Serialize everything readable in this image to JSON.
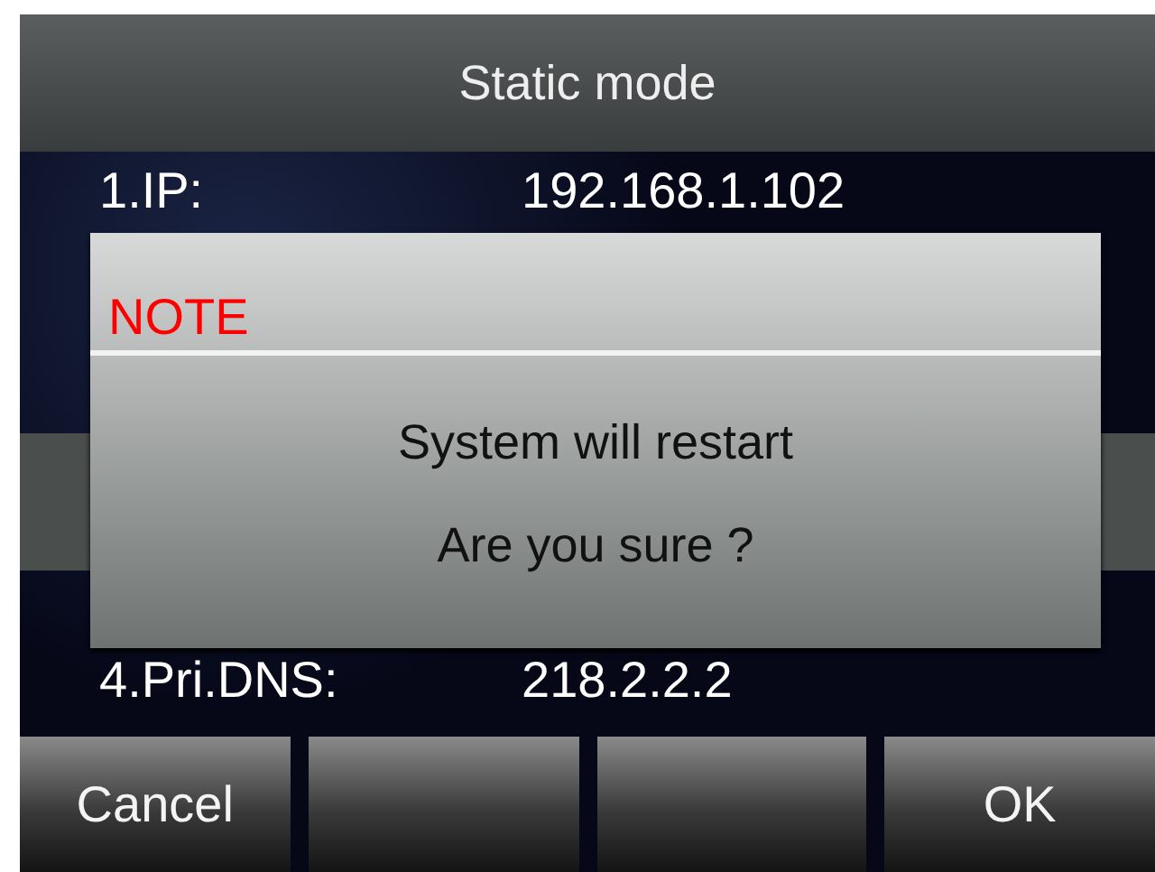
{
  "title": "Static mode",
  "rows": [
    {
      "label": "1.IP:",
      "value": "192.168.1.102",
      "selected": false
    },
    {
      "selected": false
    },
    {
      "selected": true
    },
    {
      "label": "4.Pri.DNS:",
      "value": "218.2.2.2",
      "selected": false
    }
  ],
  "dialog": {
    "title": "NOTE",
    "lines": [
      "System will restart",
      "Are you sure ?"
    ]
  },
  "softkeys": [
    {
      "kind": "text",
      "label": "Cancel"
    },
    {
      "kind": "blank"
    },
    {
      "kind": "blank"
    },
    {
      "kind": "text",
      "label": "OK"
    }
  ]
}
